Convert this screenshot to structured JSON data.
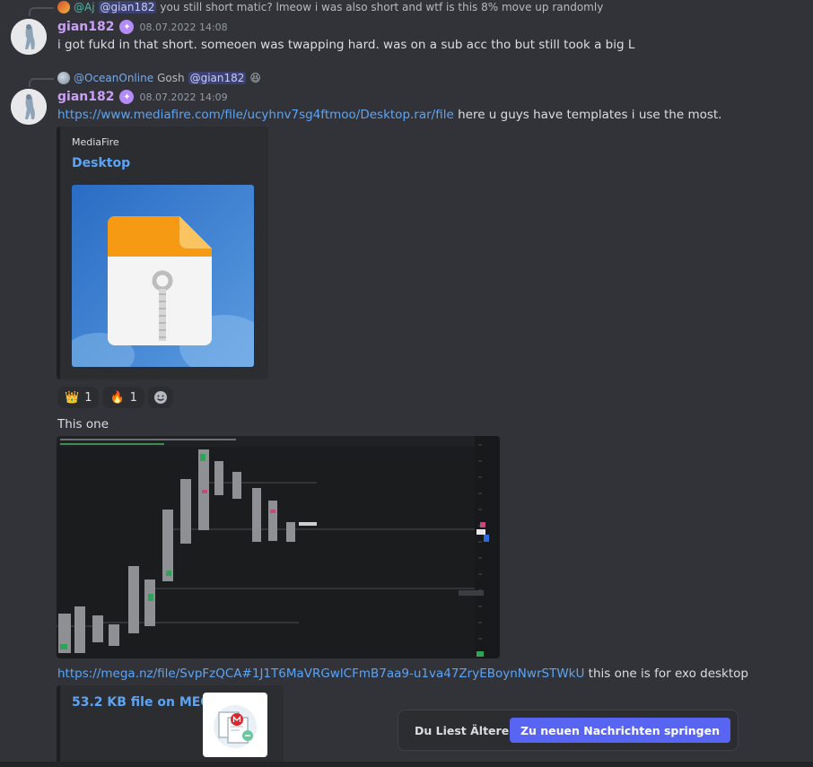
{
  "messages": [
    {
      "reply": {
        "author": "@Aj",
        "mention": "@gian182",
        "text": "you still short matic?  lmeow i was also short and wtf is this 8% move up randomly"
      },
      "author": "gian182",
      "timestamp": "08.07.2022 14:08",
      "text": "i got fukd in that short. someoen was twapping hard. was on a sub acc tho but still took a big L"
    },
    {
      "reply": {
        "author": "@OceanOnline",
        "text": "Gosh",
        "mention": "@gian182",
        "emoji": "😆"
      },
      "author": "gian182",
      "timestamp": "08.07.2022 14:09",
      "link": "https://www.mediafire.com/file/ucyhnv7sg4ftmoo/Desktop.rar/file",
      "text_after_link": "here u guys have templates i use the most.",
      "embed": {
        "provider": "MediaFire",
        "title": "Desktop"
      },
      "reactions": [
        {
          "emoji": "👑",
          "count": "1"
        },
        {
          "emoji": "🔥",
          "count": "1"
        }
      ],
      "followup_text": "This one",
      "mega_link": "https://mega.nz/file/SvpFzQCA#1J1T6MaVRGwlCFmB7aa9-u1va47ZryEBoynNwrSTWkU",
      "mega_text_after": "this one is for exo desktop",
      "mega_embed": {
        "title": "53.2 KB file on MEGA"
      }
    }
  ],
  "toast": {
    "text": "Du Liest Ältere Nachrichten",
    "button": "Zu neuen Nachrichten springen"
  },
  "colors": {
    "background": "#313338",
    "link": "#5ca4f5",
    "username": "#c9a0f5",
    "accent": "#5865f2"
  }
}
